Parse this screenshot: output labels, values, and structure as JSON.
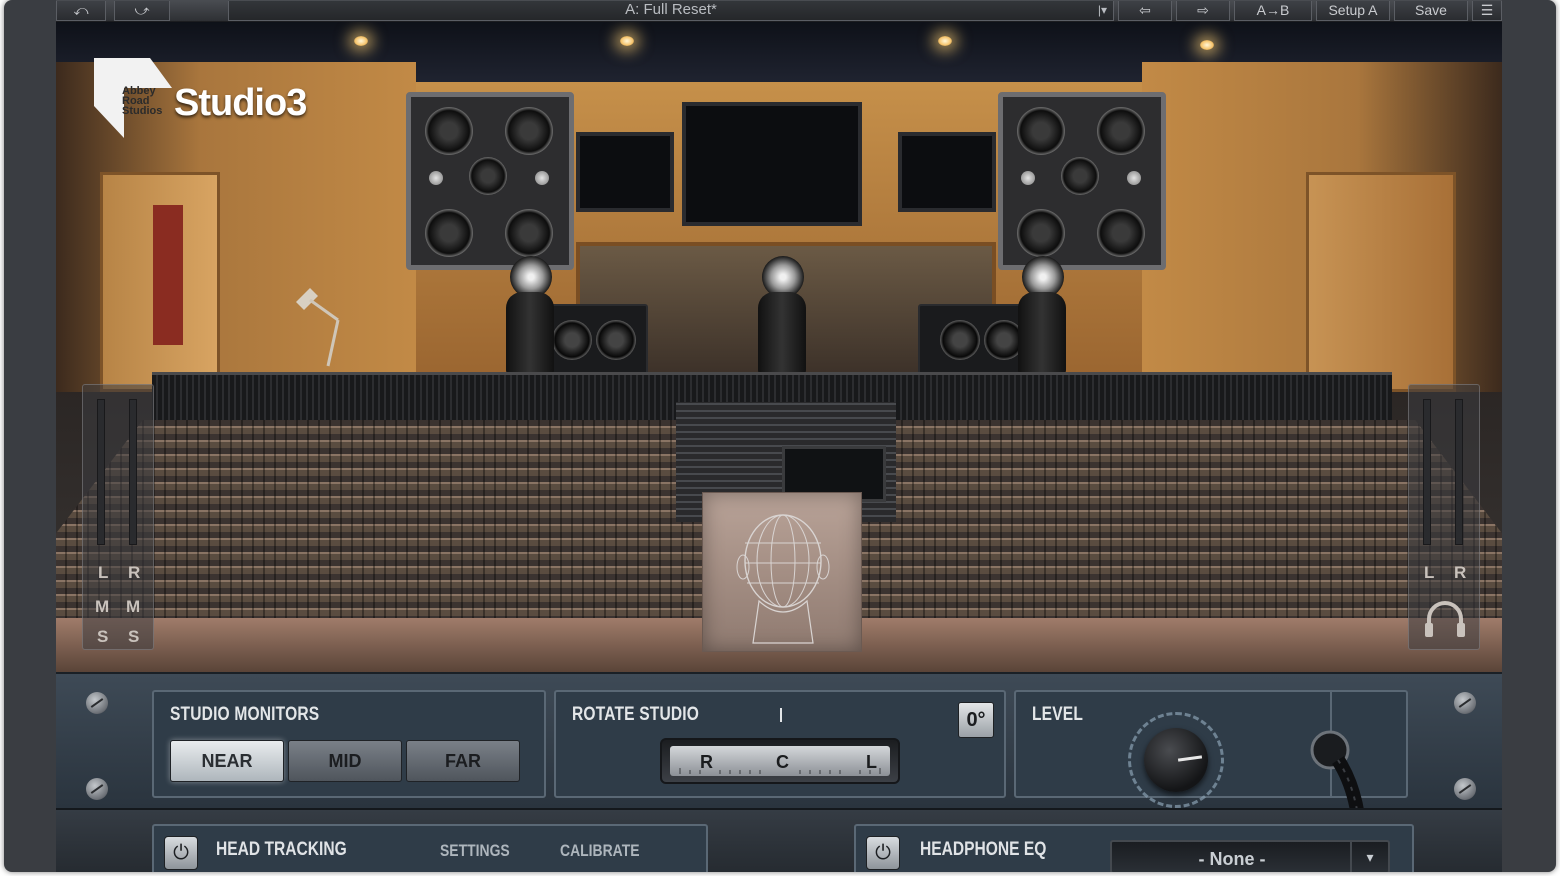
{
  "toolbar": {
    "preset": "A: Full Reset*",
    "undo_icon": "undo-icon",
    "redo_icon": "redo-icon",
    "prev_icon": "arrow-left-icon",
    "next_icon": "arrow-right-icon",
    "ab_label": "A→B",
    "setup_label": "Setup A",
    "save_label": "Save",
    "menu_icon": "menu-icon"
  },
  "brand": {
    "small_lines": [
      "Abbey",
      "Road",
      "Studios"
    ],
    "product": "Studio3"
  },
  "meters_left": {
    "label_l": "L",
    "label_r": "R",
    "m1": "M",
    "m2": "M",
    "s1": "S",
    "s2": "S"
  },
  "meters_right": {
    "label_l": "L",
    "label_r": "R",
    "headphone_icon": "headphone-icon"
  },
  "studio_monitors": {
    "title": "STUDIO MONITORS",
    "buttons": [
      "NEAR",
      "MID",
      "FAR"
    ],
    "selected": "NEAR"
  },
  "rotate_studio": {
    "title": "ROTATE STUDIO",
    "dial_labels": [
      "R",
      "C",
      "L"
    ],
    "reset_label": "0°"
  },
  "level": {
    "title": "LEVEL"
  },
  "head_tracking": {
    "title": "HEAD TRACKING",
    "settings": "SETTINGS",
    "calibrate": "CALIBRATE"
  },
  "headphone_eq": {
    "title": "HEADPHONE EQ",
    "value": "- None -"
  },
  "colors": {
    "panel": "#2f3c48",
    "button_active": "#e9ecee",
    "frame": "#3a3d42"
  }
}
